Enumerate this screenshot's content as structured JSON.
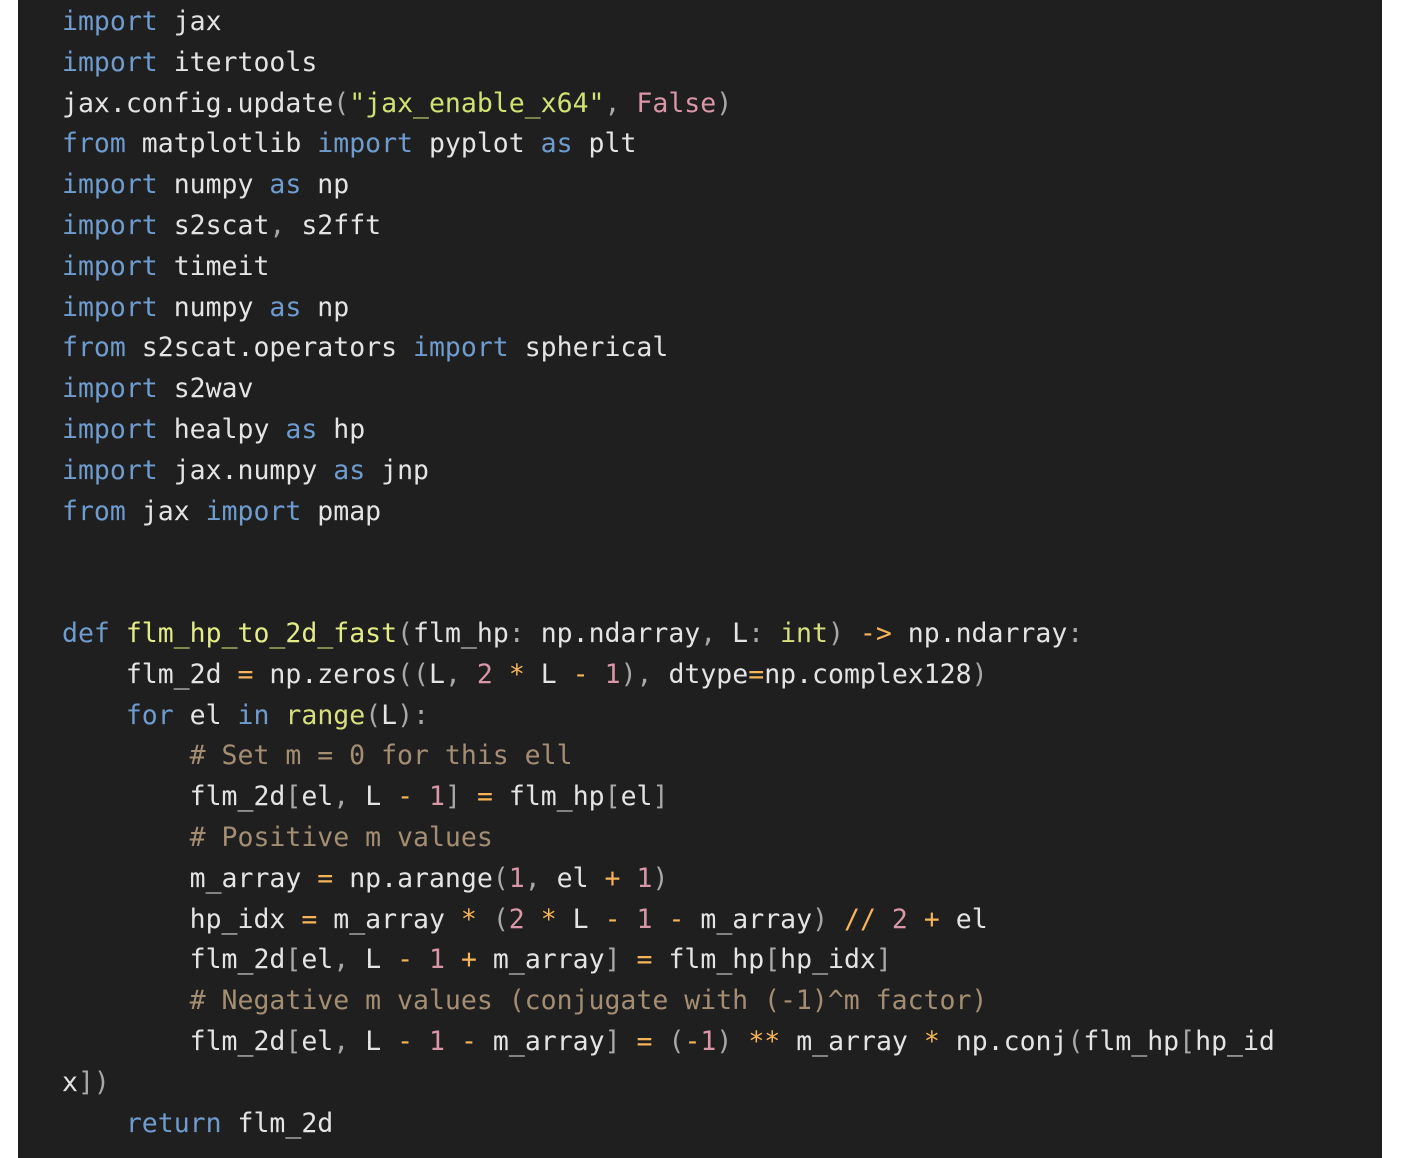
{
  "colors": {
    "background": "#1f1f1f",
    "keyword": "#6e9ccf",
    "string": "#cfe372",
    "number": "#d996a7",
    "operator": "#f6b45a",
    "function": "#e4ec86",
    "comment": "#a48e73",
    "text": "#e4e4e4"
  },
  "lines": [
    [
      [
        "kw",
        "import"
      ],
      [
        "plain",
        " jax"
      ]
    ],
    [
      [
        "kw",
        "import"
      ],
      [
        "plain",
        " itertools"
      ]
    ],
    [
      [
        "plain",
        "jax.config.update"
      ],
      [
        "punc",
        "("
      ],
      [
        "str",
        "\"jax_enable_x64\""
      ],
      [
        "punc",
        ", "
      ],
      [
        "const",
        "False"
      ],
      [
        "punc",
        ")"
      ]
    ],
    [
      [
        "kw",
        "from"
      ],
      [
        "plain",
        " matplotlib "
      ],
      [
        "kw",
        "import"
      ],
      [
        "plain",
        " pyplot "
      ],
      [
        "kw",
        "as"
      ],
      [
        "plain",
        " plt"
      ]
    ],
    [
      [
        "kw",
        "import"
      ],
      [
        "plain",
        " numpy "
      ],
      [
        "kw",
        "as"
      ],
      [
        "plain",
        " np"
      ]
    ],
    [
      [
        "kw",
        "import"
      ],
      [
        "plain",
        " s2scat"
      ],
      [
        "punc",
        ", "
      ],
      [
        "plain",
        "s2fft"
      ]
    ],
    [
      [
        "kw",
        "import"
      ],
      [
        "plain",
        " timeit"
      ]
    ],
    [
      [
        "kw",
        "import"
      ],
      [
        "plain",
        " numpy "
      ],
      [
        "kw",
        "as"
      ],
      [
        "plain",
        " np"
      ]
    ],
    [
      [
        "kw",
        "from"
      ],
      [
        "plain",
        " s2scat.operators "
      ],
      [
        "kw",
        "import"
      ],
      [
        "plain",
        " spherical"
      ]
    ],
    [
      [
        "kw",
        "import"
      ],
      [
        "plain",
        " s2wav"
      ]
    ],
    [
      [
        "kw",
        "import"
      ],
      [
        "plain",
        " healpy "
      ],
      [
        "kw",
        "as"
      ],
      [
        "plain",
        " hp"
      ]
    ],
    [
      [
        "kw",
        "import"
      ],
      [
        "plain",
        " jax.numpy "
      ],
      [
        "kw",
        "as"
      ],
      [
        "plain",
        " jnp"
      ]
    ],
    [
      [
        "kw",
        "from"
      ],
      [
        "plain",
        " jax "
      ],
      [
        "kw",
        "import"
      ],
      [
        "plain",
        " pmap"
      ]
    ],
    [],
    [],
    [
      [
        "kw",
        "def"
      ],
      [
        "plain",
        " "
      ],
      [
        "fn",
        "flm_hp_to_2d_fast"
      ],
      [
        "punc",
        "("
      ],
      [
        "plain",
        "flm_hp"
      ],
      [
        "punc",
        ": "
      ],
      [
        "plain",
        "np.ndarray"
      ],
      [
        "punc",
        ", "
      ],
      [
        "plain",
        "L"
      ],
      [
        "punc",
        ": "
      ],
      [
        "builtin",
        "int"
      ],
      [
        "punc",
        ") "
      ],
      [
        "op",
        "->"
      ],
      [
        "plain",
        " np.ndarray"
      ],
      [
        "punc",
        ":"
      ]
    ],
    [
      [
        "plain",
        "    flm_2d "
      ],
      [
        "op",
        "="
      ],
      [
        "plain",
        " np.zeros"
      ],
      [
        "punc",
        "(("
      ],
      [
        "plain",
        "L"
      ],
      [
        "punc",
        ", "
      ],
      [
        "num",
        "2"
      ],
      [
        "plain",
        " "
      ],
      [
        "op",
        "*"
      ],
      [
        "plain",
        " L "
      ],
      [
        "op",
        "-"
      ],
      [
        "plain",
        " "
      ],
      [
        "num",
        "1"
      ],
      [
        "punc",
        "), "
      ],
      [
        "plain",
        "dtype"
      ],
      [
        "op",
        "="
      ],
      [
        "plain",
        "np.complex128"
      ],
      [
        "punc",
        ")"
      ]
    ],
    [
      [
        "plain",
        "    "
      ],
      [
        "kw",
        "for"
      ],
      [
        "plain",
        " el "
      ],
      [
        "kw",
        "in"
      ],
      [
        "plain",
        " "
      ],
      [
        "builtin",
        "range"
      ],
      [
        "punc",
        "("
      ],
      [
        "plain",
        "L"
      ],
      [
        "punc",
        "):"
      ]
    ],
    [
      [
        "plain",
        "        "
      ],
      [
        "com",
        "# Set m = 0 for this ell"
      ]
    ],
    [
      [
        "plain",
        "        flm_2d"
      ],
      [
        "punc",
        "["
      ],
      [
        "plain",
        "el"
      ],
      [
        "punc",
        ", "
      ],
      [
        "plain",
        "L "
      ],
      [
        "op",
        "-"
      ],
      [
        "plain",
        " "
      ],
      [
        "num",
        "1"
      ],
      [
        "punc",
        "]"
      ],
      [
        "plain",
        " "
      ],
      [
        "op",
        "="
      ],
      [
        "plain",
        " flm_hp"
      ],
      [
        "punc",
        "["
      ],
      [
        "plain",
        "el"
      ],
      [
        "punc",
        "]"
      ]
    ],
    [
      [
        "plain",
        "        "
      ],
      [
        "com",
        "# Positive m values"
      ]
    ],
    [
      [
        "plain",
        "        m_array "
      ],
      [
        "op",
        "="
      ],
      [
        "plain",
        " np.arange"
      ],
      [
        "punc",
        "("
      ],
      [
        "num",
        "1"
      ],
      [
        "punc",
        ", "
      ],
      [
        "plain",
        "el "
      ],
      [
        "op",
        "+"
      ],
      [
        "plain",
        " "
      ],
      [
        "num",
        "1"
      ],
      [
        "punc",
        ")"
      ]
    ],
    [
      [
        "plain",
        "        hp_idx "
      ],
      [
        "op",
        "="
      ],
      [
        "plain",
        " m_array "
      ],
      [
        "op",
        "*"
      ],
      [
        "plain",
        " "
      ],
      [
        "punc",
        "("
      ],
      [
        "num",
        "2"
      ],
      [
        "plain",
        " "
      ],
      [
        "op",
        "*"
      ],
      [
        "plain",
        " L "
      ],
      [
        "op",
        "-"
      ],
      [
        "plain",
        " "
      ],
      [
        "num",
        "1"
      ],
      [
        "plain",
        " "
      ],
      [
        "op",
        "-"
      ],
      [
        "plain",
        " m_array"
      ],
      [
        "punc",
        ")"
      ],
      [
        "plain",
        " "
      ],
      [
        "op",
        "//"
      ],
      [
        "plain",
        " "
      ],
      [
        "num",
        "2"
      ],
      [
        "plain",
        " "
      ],
      [
        "op",
        "+"
      ],
      [
        "plain",
        " el"
      ]
    ],
    [
      [
        "plain",
        "        flm_2d"
      ],
      [
        "punc",
        "["
      ],
      [
        "plain",
        "el"
      ],
      [
        "punc",
        ", "
      ],
      [
        "plain",
        "L "
      ],
      [
        "op",
        "-"
      ],
      [
        "plain",
        " "
      ],
      [
        "num",
        "1"
      ],
      [
        "plain",
        " "
      ],
      [
        "op",
        "+"
      ],
      [
        "plain",
        " m_array"
      ],
      [
        "punc",
        "]"
      ],
      [
        "plain",
        " "
      ],
      [
        "op",
        "="
      ],
      [
        "plain",
        " flm_hp"
      ],
      [
        "punc",
        "["
      ],
      [
        "plain",
        "hp_idx"
      ],
      [
        "punc",
        "]"
      ]
    ],
    [
      [
        "plain",
        "        "
      ],
      [
        "com",
        "# Negative m values (conjugate with (-1)^m factor)"
      ]
    ],
    [
      [
        "plain",
        "        flm_2d"
      ],
      [
        "punc",
        "["
      ],
      [
        "plain",
        "el"
      ],
      [
        "punc",
        ", "
      ],
      [
        "plain",
        "L "
      ],
      [
        "op",
        "-"
      ],
      [
        "plain",
        " "
      ],
      [
        "num",
        "1"
      ],
      [
        "plain",
        " "
      ],
      [
        "op",
        "-"
      ],
      [
        "plain",
        " m_array"
      ],
      [
        "punc",
        "]"
      ],
      [
        "plain",
        " "
      ],
      [
        "op",
        "="
      ],
      [
        "plain",
        " "
      ],
      [
        "punc",
        "("
      ],
      [
        "op",
        "-"
      ],
      [
        "num",
        "1"
      ],
      [
        "punc",
        ")"
      ],
      [
        "plain",
        " "
      ],
      [
        "op",
        "**"
      ],
      [
        "plain",
        " m_array "
      ],
      [
        "op",
        "*"
      ],
      [
        "plain",
        " np.conj"
      ],
      [
        "punc",
        "("
      ],
      [
        "plain",
        "flm_hp"
      ],
      [
        "punc",
        "["
      ],
      [
        "plain",
        "hp_id"
      ]
    ],
    [
      [
        "plain",
        "x"
      ],
      [
        "punc",
        "])"
      ]
    ],
    [
      [
        "plain",
        "    "
      ],
      [
        "kw",
        "return"
      ],
      [
        "plain",
        " flm_2d"
      ]
    ]
  ]
}
